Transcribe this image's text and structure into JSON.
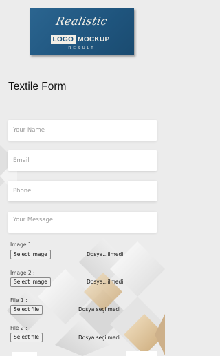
{
  "logo": {
    "script_text": "Realistic",
    "word1": "LOGO",
    "word2": "MOCKUP",
    "tagline": "RESULT"
  },
  "form": {
    "title": "Textile Form",
    "name_placeholder": "Your Name",
    "email_placeholder": "Email",
    "phone_placeholder": "Phone",
    "message_placeholder": "Your Message"
  },
  "uploads": [
    {
      "label": "Image 1 :",
      "button": "Select image",
      "status": "Dosya...ilmedi"
    },
    {
      "label": "Image 2 :",
      "button": "Select image",
      "status": "Dosya...ilmedi"
    },
    {
      "label": "File 1 :",
      "button": "Select file",
      "status": "Dosya seçilmedi"
    },
    {
      "label": "File 2 :",
      "button": "Select file",
      "status": "Dosya seçilmedi"
    }
  ],
  "colors": {
    "logo_background": "#1f557e",
    "background_diamond_gold": "#d9b98c"
  }
}
